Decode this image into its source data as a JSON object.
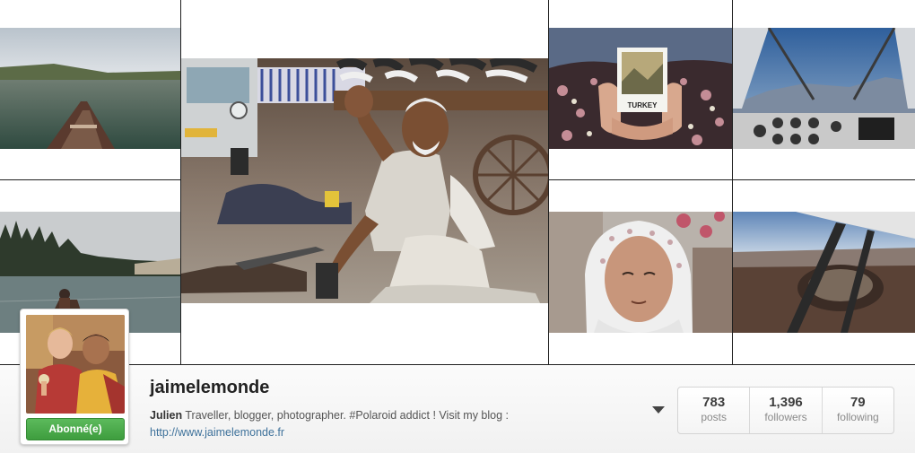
{
  "profile": {
    "username": "jaimelemonde",
    "full_name": "Julien",
    "bio": "Traveller, blogger, photographer. #Polaroid addict ! Visit my blog :",
    "website": "http://www.jaimelemonde.fr",
    "follow_button_label": "Abonné(e)"
  },
  "stats": [
    {
      "value": "783",
      "label": "posts"
    },
    {
      "value": "1,396",
      "label": "followers"
    },
    {
      "value": "79",
      "label": "following"
    }
  ],
  "photos": {
    "polaroid_caption": "TURKEY"
  },
  "colors": {
    "follow_green": "#4cae4c",
    "link_blue": "#3f729b"
  },
  "icons": {
    "dropdown": "chevron-down-icon"
  }
}
